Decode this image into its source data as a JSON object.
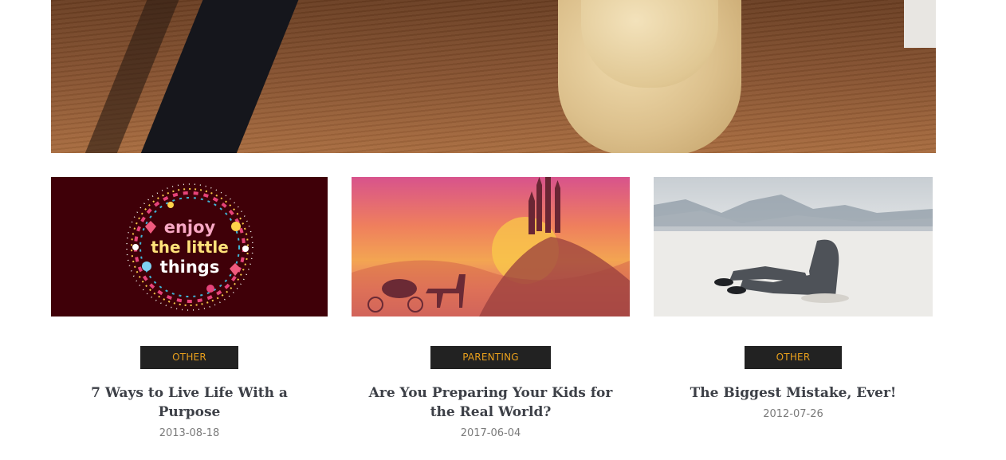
{
  "posts": [
    {
      "category": "OTHER",
      "title": "7 Ways to Live Life With a Purpose",
      "date": "2013-08-18",
      "thumb_text": [
        "enjoy",
        "the little",
        "things"
      ]
    },
    {
      "category": "PARENTING",
      "title": "Are You Preparing Your Kids for the Real World?",
      "date": "2017-06-04"
    },
    {
      "category": "OTHER",
      "title": "The Biggest Mistake, Ever!",
      "date": "2012-07-26"
    }
  ],
  "colors": {
    "badge_bg": "#222222",
    "badge_text": "#e89f1c",
    "title_text": "#3d4047",
    "date_text": "#7a7a7a"
  }
}
